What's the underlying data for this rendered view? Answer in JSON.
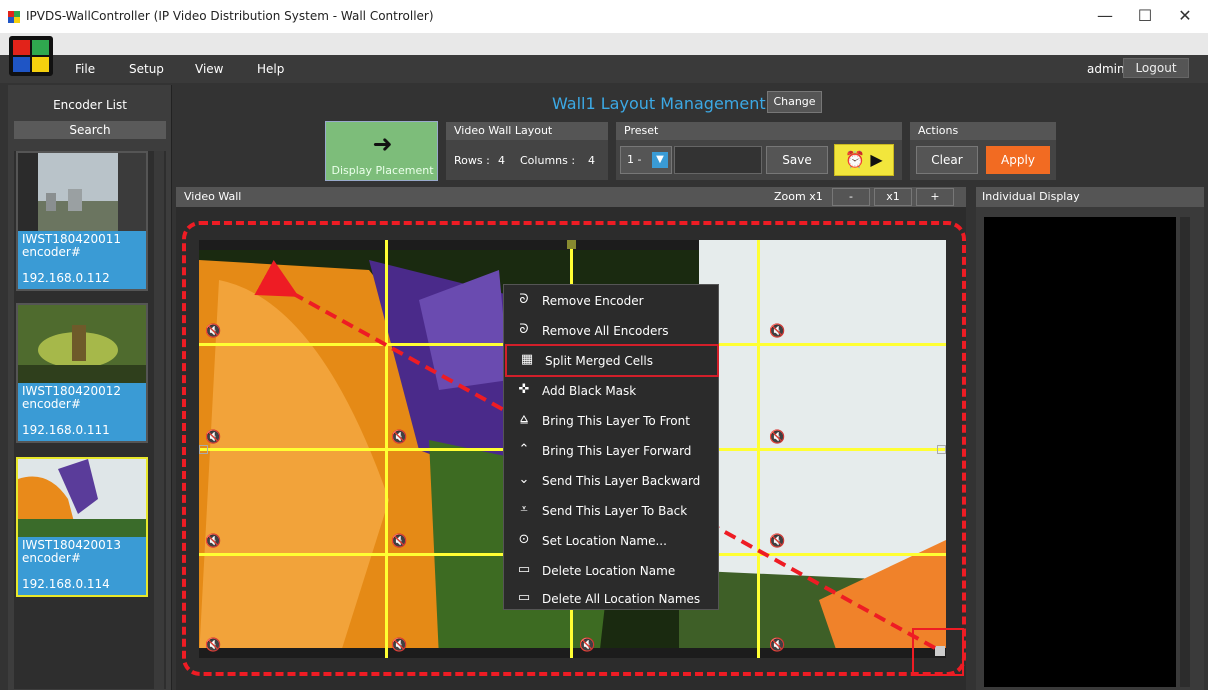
{
  "window": {
    "title": "IPVDS-WallController (IP Video Distribution System - Wall Controller)",
    "minimize": "—",
    "maximize": "☐",
    "close": "✕"
  },
  "menubar": {
    "items": [
      "File",
      "Setup",
      "View",
      "Help"
    ],
    "user": "admin",
    "logout": "Logout"
  },
  "sidebar": {
    "title": "Encoder List",
    "search": "Search",
    "encoders": [
      {
        "name": "IWST180420011 encoder#",
        "ip": "192.168.0.112",
        "selected": false
      },
      {
        "name": "IWST180420012 encoder#",
        "ip": "192.168.0.111",
        "selected": false
      },
      {
        "name": "IWST180420013 encoder#",
        "ip": "192.168.0.114",
        "selected": true
      }
    ]
  },
  "layout": {
    "title": "Wall1 Layout Management",
    "change": "Change",
    "display_placement": "Display Placement",
    "video_wall_layout": {
      "header": "Video Wall Layout",
      "rows_label": "Rows :",
      "rows": "4",
      "columns_label": "Columns :",
      "columns": "4"
    },
    "preset": {
      "header": "Preset",
      "selected": "1 -",
      "save": "Save"
    },
    "actions": {
      "header": "Actions",
      "clear": "Clear",
      "apply": "Apply"
    }
  },
  "video_wall": {
    "header": "Video Wall",
    "zoom_label": "Zoom x1",
    "zoom_minus": "-",
    "zoom_reset": "x1",
    "zoom_plus": "+"
  },
  "individual_display": {
    "header": "Individual Display"
  },
  "context_menu": {
    "items": [
      {
        "icon": "remove-encoder-icon",
        "glyph": "ᘐ",
        "label": "Remove Encoder"
      },
      {
        "icon": "remove-all-encoders-icon",
        "glyph": "ᘐ",
        "label": "Remove All Encoders"
      },
      {
        "icon": "split-cells-icon",
        "glyph": "▦",
        "label": "Split Merged Cells",
        "highlighted": true
      },
      {
        "icon": "add-mask-icon",
        "glyph": "✜",
        "label": "Add Black Mask"
      },
      {
        "icon": "bring-front-icon",
        "glyph": "⩠",
        "label": "Bring This Layer To Front"
      },
      {
        "icon": "bring-forward-icon",
        "glyph": "⌃",
        "label": "Bring This Layer Forward"
      },
      {
        "icon": "send-backward-icon",
        "glyph": "⌄",
        "label": "Send This Layer Backward"
      },
      {
        "icon": "send-back-icon",
        "glyph": "⩡",
        "label": "Send This Layer To Back"
      },
      {
        "icon": "location-pin-icon",
        "glyph": "⊙",
        "label": "Set Location Name..."
      },
      {
        "icon": "delete-location-icon",
        "glyph": "▭",
        "label": "Delete Location Name"
      },
      {
        "icon": "delete-all-locations-icon",
        "glyph": "▭",
        "label": "Delete All Location Names"
      }
    ]
  },
  "colors": {
    "accent": "#3ca9e5",
    "apply": "#f26b22",
    "grid_line": "#ffff33",
    "annotation": "#ee1c24",
    "encoder_card": "#3a9bd5"
  }
}
